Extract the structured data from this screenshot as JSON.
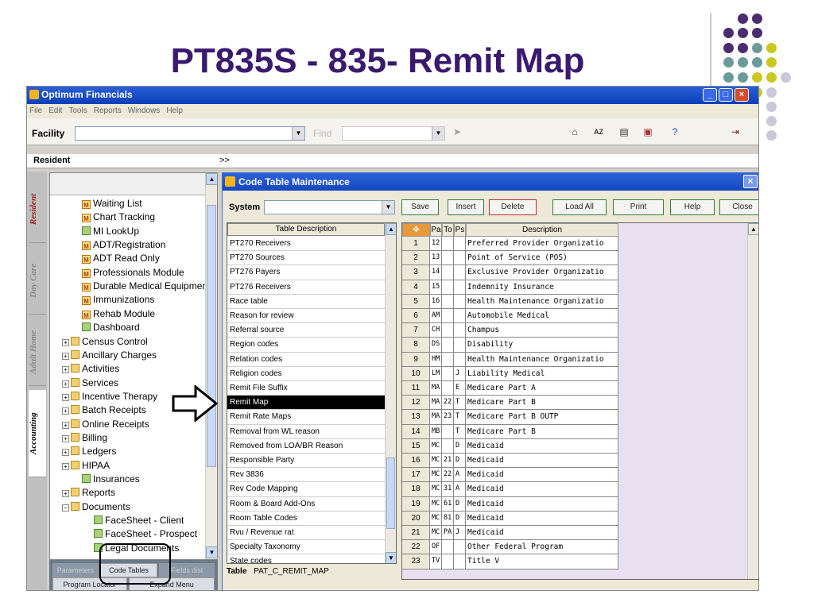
{
  "slide": {
    "title": "PT835S   -   835- Remit Map",
    "dot_colors": [
      "#4b2c6e",
      "#6a9a9a",
      "#c8c820",
      "#c8c8d8"
    ]
  },
  "window": {
    "title": "Optimum Financials",
    "menu": [
      "File",
      "Edit",
      "Tools",
      "Reports",
      "Windows",
      "Help"
    ]
  },
  "toolbar": {
    "facility_label": "Facility",
    "find_label": "Find",
    "icons": [
      "home-icon",
      "sort-icon",
      "copy-icon",
      "window-icon",
      "help-icon",
      "exit-icon"
    ]
  },
  "resident_bar": {
    "label": "Resident",
    "expand": ">>"
  },
  "side_tabs": [
    "Resident",
    "Day Care",
    "Adult Home",
    "Accounting"
  ],
  "tree": {
    "items": [
      {
        "label": "Waiting List",
        "icon": "m"
      },
      {
        "label": "Chart Tracking",
        "icon": "m"
      },
      {
        "label": "MI LookUp",
        "icon": "s"
      },
      {
        "label": "ADT/Registration",
        "icon": "m"
      },
      {
        "label": "ADT Read Only",
        "icon": "m"
      },
      {
        "label": "Professionals Module",
        "icon": "m"
      },
      {
        "label": "Durable Medical Equipment",
        "icon": "m"
      },
      {
        "label": "Immunizations",
        "icon": "m"
      },
      {
        "label": "Rehab Module",
        "icon": "m"
      },
      {
        "label": "Dashboard",
        "icon": "s"
      },
      {
        "label": "Census Control",
        "icon": "f"
      },
      {
        "label": "Ancillary Charges",
        "icon": "f"
      },
      {
        "label": "Activities",
        "icon": "f"
      },
      {
        "label": "Services",
        "icon": "f"
      },
      {
        "label": "Incentive Therapy",
        "icon": "f"
      },
      {
        "label": "Batch Receipts",
        "icon": "f"
      },
      {
        "label": "Online Receipts",
        "icon": "f"
      },
      {
        "label": "Billing",
        "icon": "f"
      },
      {
        "label": "Ledgers",
        "icon": "f"
      },
      {
        "label": "HIPAA",
        "icon": "f"
      },
      {
        "label": "Insurances",
        "icon": "s"
      },
      {
        "label": "Reports",
        "icon": "f"
      },
      {
        "label": "Documents",
        "icon": "f"
      },
      {
        "label": "FaceSheet - Client",
        "icon": "s"
      },
      {
        "label": "FaceSheet - Prospect",
        "icon": "s"
      },
      {
        "label": "Legal Documents",
        "icon": "s"
      }
    ],
    "bottom_buttons": [
      "Parameters",
      "Code Tables",
      "Fields dist",
      "Program Locator",
      "Expand Menu"
    ]
  },
  "dialog": {
    "title": "Code Table Maintenance",
    "system_label": "System",
    "buttons": [
      "Save",
      "Insert",
      "Delete",
      "Load All",
      "Print",
      "Help",
      "Close"
    ],
    "list_header": "Table Description",
    "list_items": [
      "PT270 Receivers",
      "PT270 Sources",
      "PT276 Payers",
      "PT276 Receivers",
      "Race table",
      "Reason for review",
      "Referral source",
      "Region codes",
      "Relation codes",
      "Religion codes",
      "Remit File Suffix",
      "Remit Map",
      "Remit Rate Maps",
      "Removal from WL reason",
      "Removed from LOA/BR Reason",
      "Responsible Party",
      "Rev 3836",
      "Rev Code Mapping",
      "Room & Board Add-Ons",
      "Room Table Codes",
      "Rvu / Revenue rat",
      "Specialty Taxonomy",
      "State codes"
    ],
    "selected_index": 11,
    "table_label": "Table",
    "table_name": "PAT_C_REMIT_MAP",
    "grid_headers": [
      "Pa",
      "To",
      "Ps",
      "Description"
    ],
    "grid_rows": [
      [
        "1",
        "12",
        "",
        "",
        "Preferred Provider Organizatio"
      ],
      [
        "2",
        "13",
        "",
        "",
        "Point of Service (POS)"
      ],
      [
        "3",
        "14",
        "",
        "",
        "Exclusive Provider Organizatio"
      ],
      [
        "4",
        "15",
        "",
        "",
        "Indemnity Insurance"
      ],
      [
        "5",
        "16",
        "",
        "",
        "Health Maintenance Organizatio"
      ],
      [
        "6",
        "AM",
        "",
        "",
        "Automobile Medical"
      ],
      [
        "7",
        "CH",
        "",
        "",
        "Champus"
      ],
      [
        "8",
        "DS",
        "",
        "",
        "Disability"
      ],
      [
        "9",
        "HM",
        "",
        "",
        "Health Maintenance Organizatio"
      ],
      [
        "10",
        "LM",
        "",
        "J",
        "Liability Medical"
      ],
      [
        "11",
        "MA",
        "",
        "E",
        "Medicare Part A"
      ],
      [
        "12",
        "MA",
        "22",
        "T",
        "Medicare Part B"
      ],
      [
        "13",
        "MA",
        "23",
        "T",
        "Medicare Part B OUTP"
      ],
      [
        "14",
        "MB",
        "",
        "T",
        "Medicare Part B"
      ],
      [
        "15",
        "MC",
        "",
        "D",
        "Medicaid"
      ],
      [
        "16",
        "MC",
        "21",
        "D",
        "Medicaid"
      ],
      [
        "17",
        "MC",
        "22",
        "A",
        "Medicaid"
      ],
      [
        "18",
        "MC",
        "31",
        "A",
        "Medicaid"
      ],
      [
        "19",
        "MC",
        "61",
        "D",
        "Medicaid"
      ],
      [
        "20",
        "MC",
        "81",
        "D",
        "Medicaid"
      ],
      [
        "21",
        "MC",
        "PA",
        "J",
        "Medicaid"
      ],
      [
        "22",
        "OF",
        "",
        "",
        "Other Federal Program"
      ],
      [
        "23",
        "TV",
        "",
        "",
        "Title V"
      ]
    ]
  }
}
